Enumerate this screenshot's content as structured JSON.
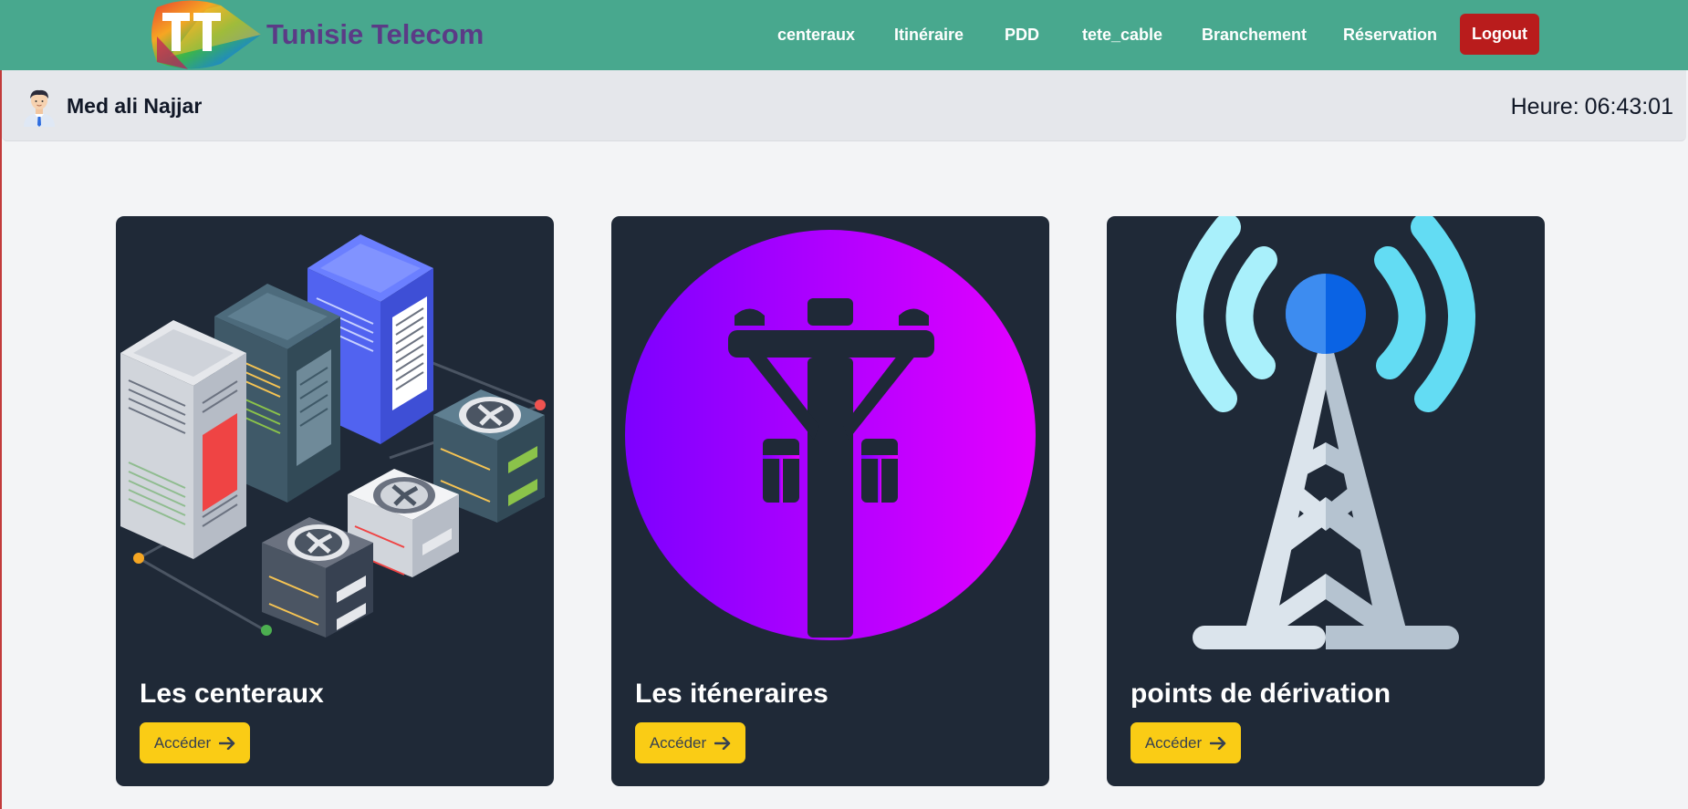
{
  "brand": {
    "name": "Tunisie Telecom",
    "logo_icon": "tt-logo-icon"
  },
  "nav": {
    "items": [
      {
        "label": "centeraux"
      },
      {
        "label": "Itinéraire"
      },
      {
        "label": "PDD"
      },
      {
        "label": "tete_cable"
      },
      {
        "label": "Branchement"
      },
      {
        "label": "Réservation"
      }
    ],
    "logout_label": "Logout"
  },
  "user": {
    "name": "Med ali Najjar",
    "avatar_icon": "user-avatar-icon"
  },
  "clock": {
    "label": "Heure:",
    "time": "06:43:01"
  },
  "cards": [
    {
      "title": "Les centeraux",
      "button_label": "Accéder",
      "icon": "server-rack-illustration"
    },
    {
      "title": "Les iténeraires",
      "button_label": "Accéder",
      "icon": "utility-pole-icon"
    },
    {
      "title": "points de dérivation",
      "button_label": "Accéder",
      "icon": "antenna-tower-icon"
    }
  ],
  "colors": {
    "navbar": "#48a88e",
    "brand_text": "#5b3b86",
    "logout": "#b91c1c",
    "card_bg": "#1f2937",
    "button": "#facc15",
    "page_bg": "#f3f4f6"
  }
}
